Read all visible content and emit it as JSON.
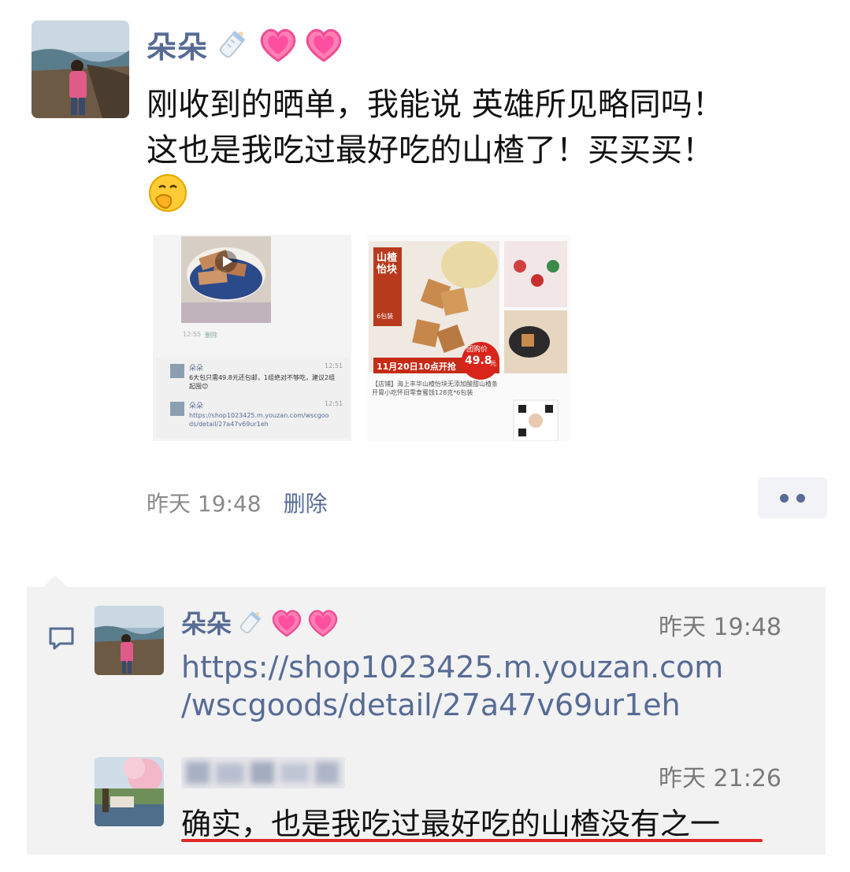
{
  "post": {
    "author": "朵朵",
    "name_icons": [
      "baby-bottle-icon",
      "sparkling-heart-icon",
      "sparkling-heart-icon"
    ],
    "text_lines": [
      "刚收到的晒单，我能说 英雄所见略同吗！",
      "这也是我吃过最好吃的山楂了！买买买！"
    ],
    "trailing_emoji": "face-with-hand-over-mouth-icon",
    "time": "昨天 19:48",
    "delete_label": "删除",
    "image1": {
      "time": "12:55",
      "action": "删除",
      "comments": [
        {
          "name": "朵朵",
          "time": "12:51",
          "text": "6大包只需49.8元还包邮，1组绝对不够吃，建议2组起囤😊"
        },
        {
          "name": "朵朵",
          "time": "12:51",
          "text": "https://shop1023425.m.youzan.com/wscgoods/detail/27a47v69ur1eh"
        }
      ]
    },
    "image2": {
      "title": "山楂怡块",
      "badge": "6包装",
      "sale_label": "11月20日10点开抢",
      "price_label": "团购价",
      "price": "49.8",
      "price_unit": "元",
      "desc": "【店铺】海上丰华山楂怡块无添加酸甜山楂条 开胃小吃怀旧零食蜜饯128克*6包装"
    }
  },
  "comments": [
    {
      "author": "朵朵",
      "name_icons": [
        "baby-bottle-icon",
        "sparkling-heart-icon",
        "sparkling-heart-icon"
      ],
      "time": "昨天 19:48",
      "text_lines": [
        "https://shop1023425.m.youzan.com",
        "/wscgoods/detail/27a47v69ur1eh"
      ]
    },
    {
      "author": "",
      "time": "昨天 21:26",
      "text": "确实，也是我吃过最好吃的山楂没有之一"
    }
  ],
  "colors": {
    "link": "#576b95",
    "comment_bg": "#f2f2f2",
    "underline": "#e02a2a",
    "time_gray": "#8a8a8a"
  }
}
